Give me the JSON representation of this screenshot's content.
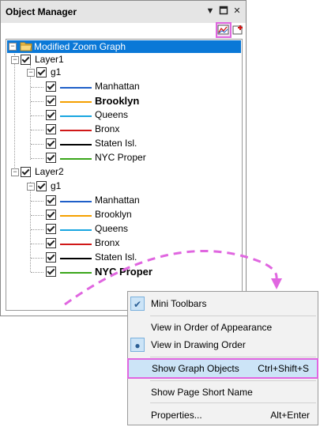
{
  "window": {
    "title": "Object Manager",
    "pin_icon": "pin-dropdown-icon",
    "maximize_icon": "maximize-icon",
    "close_icon": "close-icon"
  },
  "toolbar": {
    "icons": [
      "graph-objects-icon",
      "add-layer-icon"
    ]
  },
  "tree": {
    "root_label": "Modified Zoom Graph",
    "layers": [
      {
        "label": "Layer1",
        "group": "g1",
        "plots": [
          {
            "label": "Manhattan",
            "color": "#1f5fc8",
            "bold": false
          },
          {
            "label": "Brooklyn",
            "color": "#f5a000",
            "bold": true
          },
          {
            "label": "Queens",
            "color": "#19a6e0",
            "bold": false
          },
          {
            "label": "Bronx",
            "color": "#d01818",
            "bold": false
          },
          {
            "label": "Staten Isl.",
            "color": "#000000",
            "bold": false
          },
          {
            "label": "NYC Proper",
            "color": "#3aa61a",
            "bold": false
          }
        ]
      },
      {
        "label": "Layer2",
        "group": "g1",
        "plots": [
          {
            "label": "Manhattan",
            "color": "#1f5fc8",
            "bold": false
          },
          {
            "label": "Brooklyn",
            "color": "#f5a000",
            "bold": false
          },
          {
            "label": "Queens",
            "color": "#19a6e0",
            "bold": false
          },
          {
            "label": "Bronx",
            "color": "#d01818",
            "bold": false
          },
          {
            "label": "Staten Isl.",
            "color": "#000000",
            "bold": false
          },
          {
            "label": "NYC Proper",
            "color": "#3aa61a",
            "bold": true
          }
        ]
      }
    ]
  },
  "context_menu": {
    "items": [
      {
        "label": "Mini Toolbars",
        "shortcut": "",
        "mark": "check"
      },
      {
        "label": "View in Order of Appearance",
        "shortcut": "",
        "mark": ""
      },
      {
        "label": "View in Drawing Order",
        "shortcut": "",
        "mark": "radio"
      },
      {
        "label": "Show Graph Objects",
        "shortcut": "Ctrl+Shift+S",
        "mark": ""
      },
      {
        "label": "Show Page Short Name",
        "shortcut": "",
        "mark": ""
      },
      {
        "label": "Properties...",
        "shortcut": "Alt+Enter",
        "mark": ""
      }
    ]
  },
  "colors": {
    "selection": "#0a78d7",
    "highlight_annotation": "#e066e0",
    "menu_hover": "#cce4f7"
  }
}
